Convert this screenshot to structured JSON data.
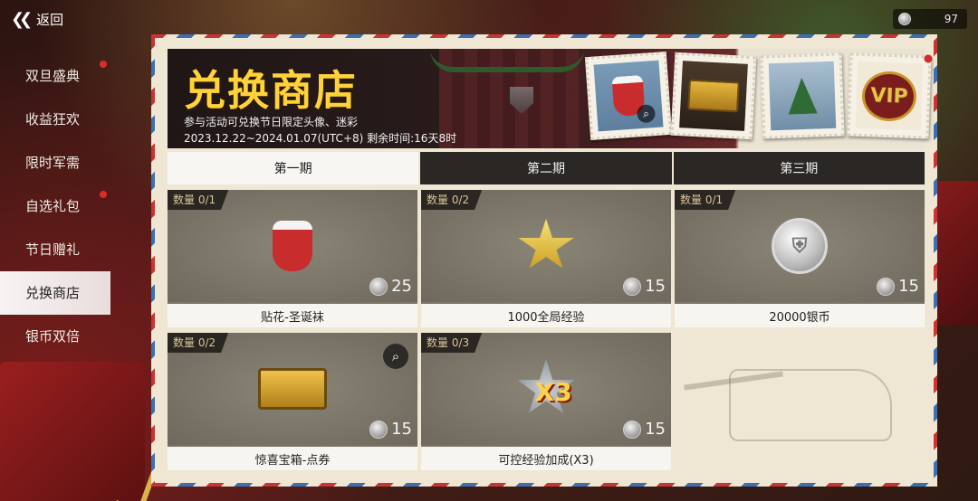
{
  "topbar": {
    "back_label": "返回",
    "currency_amount": "97"
  },
  "sidebar": {
    "items": [
      {
        "label": "双旦盛典",
        "badge": true
      },
      {
        "label": "收益狂欢",
        "badge": false
      },
      {
        "label": "限时军需",
        "badge": false
      },
      {
        "label": "自选礼包",
        "badge": true
      },
      {
        "label": "节日赠礼",
        "badge": false
      },
      {
        "label": "兑换商店",
        "badge": false,
        "active": true
      },
      {
        "label": "银币双倍",
        "badge": false
      }
    ]
  },
  "banner": {
    "title": "兑换商店",
    "subtitle": "参与活动可兑换节日限定头像、迷彩",
    "dates": "2023.12.22~2024.01.07(UTC+8)  剩余时间:16天8时",
    "stamps": [
      "sock-stamp",
      "chest-stamp",
      "tree-sock-stamp",
      "vip-stamp"
    ],
    "vip_label": "VIP"
  },
  "tabs": [
    {
      "label": "第一期",
      "active": true
    },
    {
      "label": "第二期",
      "active": false
    },
    {
      "label": "第三期",
      "active": false
    }
  ],
  "items": [
    {
      "qty": "数量 0/1",
      "price": "25",
      "name": "贴花-圣诞袜",
      "icon": "christmas-sock-icon"
    },
    {
      "qty": "数量 0/2",
      "price": "15",
      "name": "1000全局经验",
      "icon": "gold-star-icon"
    },
    {
      "qty": "数量 0/1",
      "price": "15",
      "name": "20000银币",
      "icon": "silver-coin-icon"
    },
    {
      "qty": "数量 0/2",
      "price": "15",
      "name": "惊喜宝箱-点券",
      "icon": "treasure-chest-icon"
    },
    {
      "qty": "数量 0/3",
      "price": "15",
      "name": "可控经验加成(X3)",
      "icon": "xp-boost-icon",
      "badge_text": "X3"
    }
  ],
  "colors": {
    "title_yellow": "#ffd23a",
    "badge_red": "#e02a2a",
    "tab_dark": "#2a2725",
    "tab_active": "#f8f6f2",
    "item_bg": "#7a7468"
  }
}
